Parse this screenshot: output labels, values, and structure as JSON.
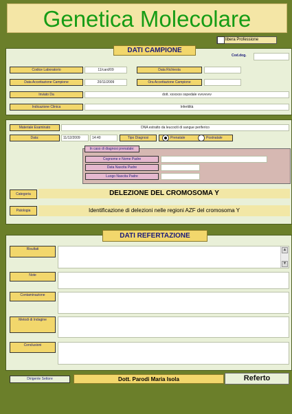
{
  "header": {
    "title": "Genetica Molecolare"
  },
  "libera_professione": {
    "label": "libera Professione",
    "checked": false
  },
  "campione": {
    "title": "DATI CAMPIONE",
    "cod_dog_label": "Cod.dog.",
    "cod_dog_value": "",
    "codice_laboratorio_label": "Codice Laboratorio",
    "codice_laboratorio_value": "11/card/09",
    "data_richiesta_label": "Data Richiesta",
    "data_richiesta_value": "",
    "data_accettazione_label": "Data Accettazione Campione",
    "data_accettazione_value": "20/11/2009",
    "ora_accettazione_label": "Ora Accettazione Campione",
    "ora_accettazione_value": "",
    "inviato_da_label": "Inviato Da",
    "inviato_da_value": "dott. xxxxxxx ospedale vvvvvvvv",
    "indicazione_clinica_label": "Indicazione Clinica",
    "indicazione_clinica_value": "Infertilità"
  },
  "materiale": {
    "materiale_label": "Materiale Esaminato",
    "materiale_value": "DNA estratto da leucociti di sangue periferico",
    "data_label": "Data:",
    "data_value": "11/12/2009",
    "ora_value": "14:40",
    "tipo_diagnosi_label": "Tipo Diagnosi",
    "tipo_options": [
      "Prenatale",
      "Postnatale"
    ],
    "tipo_selected": "Prenatale",
    "prenatale_header": "In caso di diagnosi prenatale:",
    "cognome_padre_label": "Cognome e Nome Padre",
    "cognome_padre_value": "",
    "data_nascita_padre_label": "Data Nascita Padre",
    "data_nascita_padre_value": "",
    "luogo_nascita_padre_label": "Luogo Nascita Padre",
    "luogo_nascita_padre_value": "",
    "categoria_label": "Categoria",
    "categoria_value": "DELEZIONE DEL CROMOSOMA Y",
    "patologia_label": "Patologia",
    "patologia_value": "Identificazione di delezioni nelle regioni AZF del cromosoma Y"
  },
  "refertazione": {
    "title": "DATI REFERTAZIONE",
    "risultati_label": "Risultati",
    "risultati_value": "",
    "note_label": "Note",
    "note_value": "",
    "contaminazione_label": "Contaminazione",
    "contaminazione_value": "",
    "metodi_label": "Metodi di Indagine",
    "metodi_value": "",
    "conclusioni_label": "Conclusioni",
    "conclusioni_value": ""
  },
  "footer": {
    "dirigente_label": "Dirigente Settore",
    "dirigente_value": "Dott. Parodi Maria Isola",
    "referto_button": "Referto"
  },
  "colors": {
    "background": "#6b7f2a",
    "title_text": "#169c16",
    "label_bg": "#f2d76c",
    "panel_bg": "#e9f0d8",
    "pink": "#e6b8cf"
  }
}
